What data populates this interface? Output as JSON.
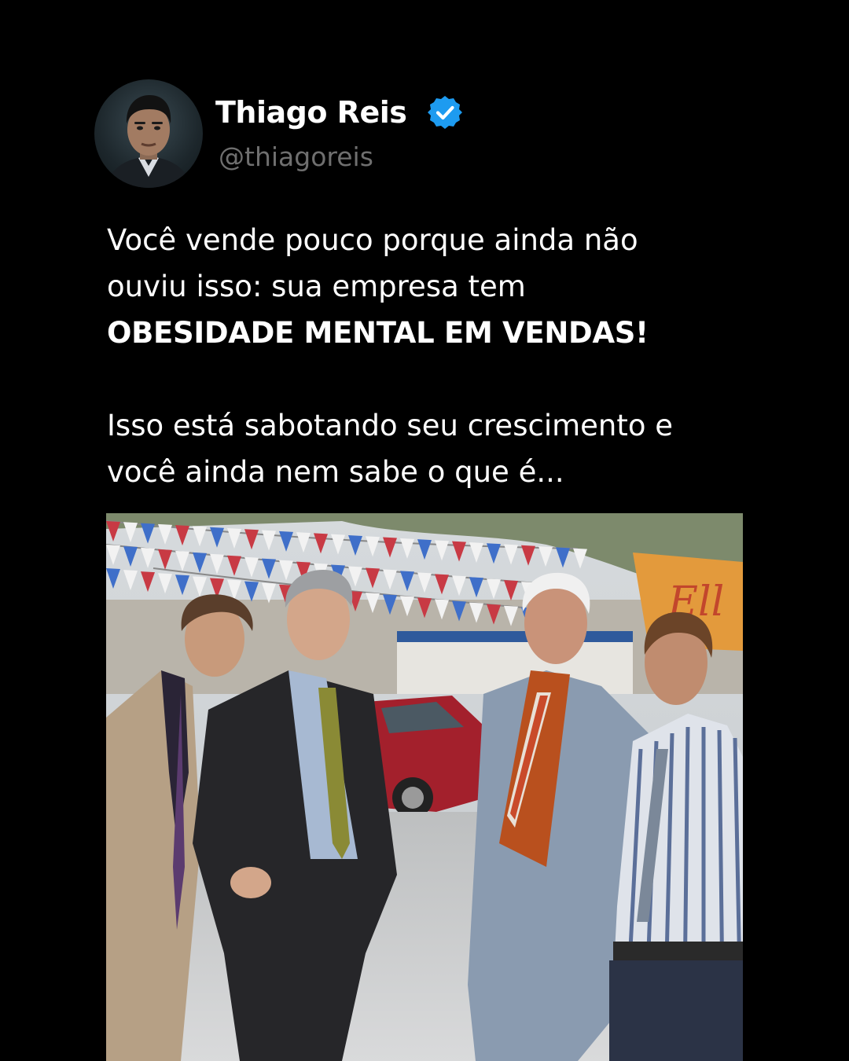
{
  "author": {
    "name": "Thiago Reis",
    "handle": "@thiagoreis",
    "verified": true,
    "avatar_icon": "profile-photo"
  },
  "post": {
    "line1": "Você vende pouco porque ainda não",
    "line2": "ouviu isso: sua empresa tem",
    "line3_emphasis": "OBESIDADE MENTAL EM VENDAS!",
    "line4": "Isso está sabotando seu crescimento e",
    "line5": "você ainda nem sabe o que é..."
  },
  "image": {
    "sign_text": "Ell"
  },
  "colors": {
    "background": "#000000",
    "text": "#ffffff",
    "handle": "#6f6f6f",
    "verified": "#1d9bf0"
  }
}
